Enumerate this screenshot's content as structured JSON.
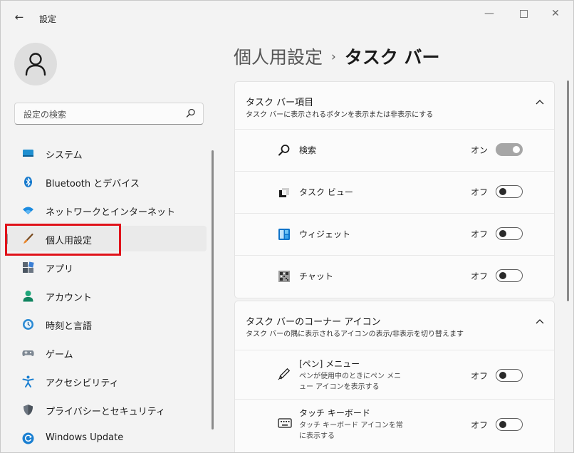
{
  "window": {
    "title": "設定",
    "back_glyph": "←",
    "minimize_glyph": "—",
    "close_glyph": "✕"
  },
  "search": {
    "placeholder": "設定の検索"
  },
  "nav": {
    "items": [
      {
        "label": "システム",
        "icon": "system-icon"
      },
      {
        "label": "Bluetooth とデバイス",
        "icon": "bluetooth-icon"
      },
      {
        "label": "ネットワークとインターネット",
        "icon": "wifi-icon"
      },
      {
        "label": "個人用設定",
        "icon": "brush-icon",
        "selected": true
      },
      {
        "label": "アプリ",
        "icon": "apps-icon"
      },
      {
        "label": "アカウント",
        "icon": "account-icon"
      },
      {
        "label": "時刻と言語",
        "icon": "time-language-icon"
      },
      {
        "label": "ゲーム",
        "icon": "gamepad-icon"
      },
      {
        "label": "アクセシビリティ",
        "icon": "accessibility-icon"
      },
      {
        "label": "プライバシーとセキュリティ",
        "icon": "shield-icon"
      },
      {
        "label": "Windows Update",
        "icon": "update-icon"
      }
    ]
  },
  "breadcrumb": {
    "parent": "個人用設定",
    "separator": "›",
    "current": "タスク バー"
  },
  "sections": [
    {
      "title": "タスク バー項目",
      "subtitle": "タスク バーに表示されるボタンを表示または非表示にする",
      "rows": [
        {
          "label": "検索",
          "state": "オン",
          "on": true,
          "icon": "search-icon"
        },
        {
          "label": "タスク ビュー",
          "state": "オフ",
          "on": false,
          "icon": "task-view-icon"
        },
        {
          "label": "ウィジェット",
          "state": "オフ",
          "on": false,
          "icon": "widgets-icon"
        },
        {
          "label": "チャット",
          "state": "オフ",
          "on": false,
          "icon": "chat-icon"
        }
      ]
    },
    {
      "title": "タスク バーのコーナー アイコン",
      "subtitle": "タスク バーの隅に表示されるアイコンの表示/非表示を切り替えます",
      "rows": [
        {
          "label": "[ペン] メニュー",
          "desc": "ペンが使用中のときにペン メニュー アイコンを表示する",
          "state": "オフ",
          "on": false,
          "icon": "pen-icon"
        },
        {
          "label": "タッチ キーボード",
          "desc": "タッチ キーボード アイコンを常に表示する",
          "state": "オフ",
          "on": false,
          "icon": "keyboard-icon"
        }
      ]
    }
  ],
  "colors": {
    "accent_highlight": "#e0121a",
    "window_bg": "#f3f3f3",
    "card_bg": "#fbfbfb",
    "toggle_on": "#a6a6a6"
  }
}
